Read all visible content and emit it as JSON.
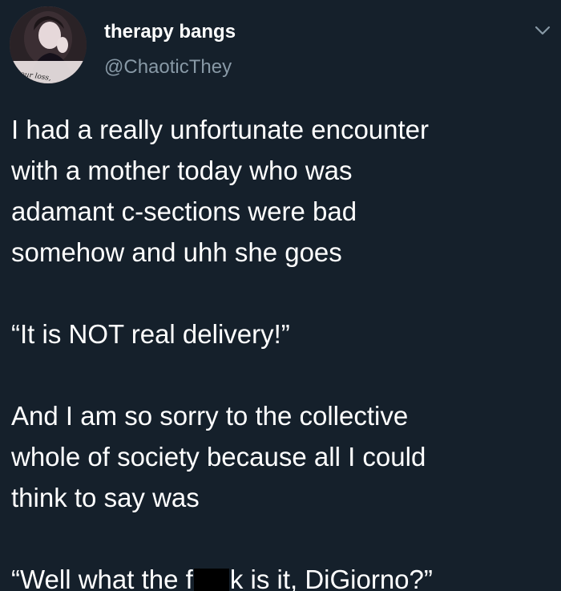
{
  "author": {
    "display_name": "therapy bangs",
    "handle": "@ChaoticThey",
    "avatar_caption": "your loss,"
  },
  "menu_icon": "chevron-down-icon",
  "colors": {
    "background": "#15202b",
    "text": "#ffffff",
    "secondary_text": "#8899a6",
    "redaction": "#000000"
  },
  "tweet": {
    "para1": {
      "line1": "I had a really unfortunate encounter",
      "line2": "with a mother today who was",
      "line3": "adamant c-sections were bad",
      "line4": "somehow and uhh she goes"
    },
    "para2": {
      "line1": "“It is NOT real delivery!”"
    },
    "para3": {
      "line1": "And I am so sorry to the collective",
      "line2": "whole of society because all I could",
      "line3": "think to say was"
    },
    "para4": {
      "before_redaction": "“Well what the f",
      "after_redaction": "k is it, DiGiorno?”"
    }
  }
}
